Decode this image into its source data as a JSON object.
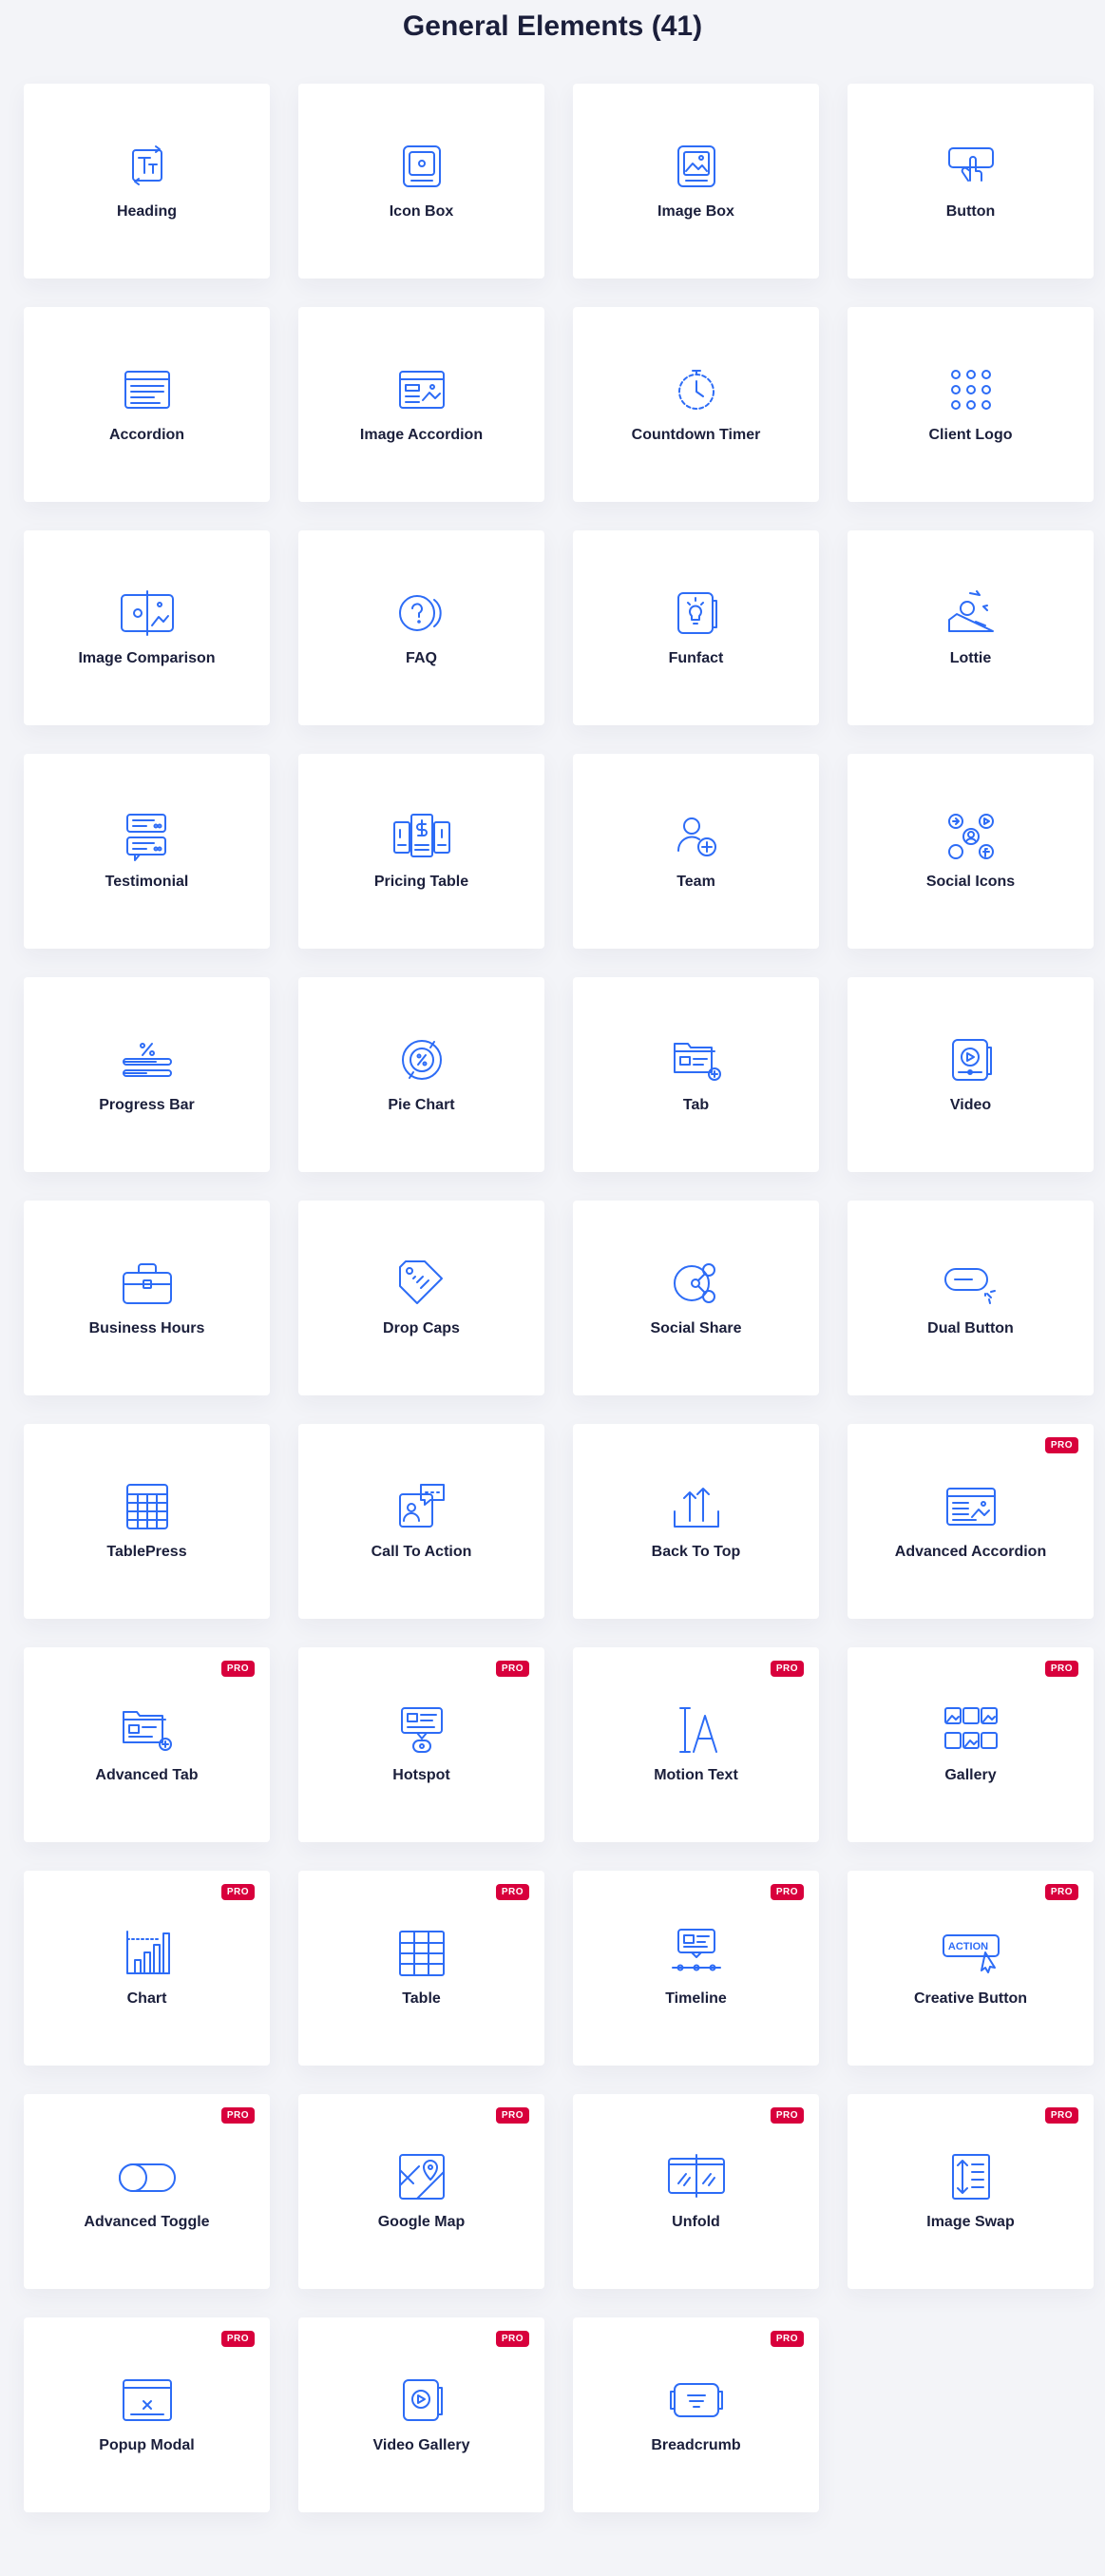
{
  "page": {
    "title": "General Elements (41)"
  },
  "badge_label": "PRO",
  "colors": {
    "icon": "#2d6cf6",
    "pro_badge": "#d8003c",
    "text": "#1b1f3b"
  },
  "elements": [
    {
      "label": "Heading",
      "icon": "heading-icon",
      "pro": false
    },
    {
      "label": "Icon Box",
      "icon": "icon-box-icon",
      "pro": false
    },
    {
      "label": "Image Box",
      "icon": "image-box-icon",
      "pro": false
    },
    {
      "label": "Button",
      "icon": "button-icon",
      "pro": false
    },
    {
      "label": "Accordion",
      "icon": "accordion-icon",
      "pro": false
    },
    {
      "label": "Image Accordion",
      "icon": "image-accordion-icon",
      "pro": false
    },
    {
      "label": "Countdown Timer",
      "icon": "countdown-timer-icon",
      "pro": false
    },
    {
      "label": "Client Logo",
      "icon": "client-logo-icon",
      "pro": false
    },
    {
      "label": "Image Comparison",
      "icon": "image-comparison-icon",
      "pro": false
    },
    {
      "label": "FAQ",
      "icon": "faq-icon",
      "pro": false
    },
    {
      "label": "Funfact",
      "icon": "funfact-icon",
      "pro": false
    },
    {
      "label": "Lottie",
      "icon": "lottie-icon",
      "pro": false
    },
    {
      "label": "Testimonial",
      "icon": "testimonial-icon",
      "pro": false
    },
    {
      "label": "Pricing Table",
      "icon": "pricing-table-icon",
      "pro": false
    },
    {
      "label": "Team",
      "icon": "team-icon",
      "pro": false
    },
    {
      "label": "Social Icons",
      "icon": "social-icons-icon",
      "pro": false
    },
    {
      "label": "Progress Bar",
      "icon": "progress-bar-icon",
      "pro": false
    },
    {
      "label": "Pie Chart",
      "icon": "pie-chart-icon",
      "pro": false
    },
    {
      "label": "Tab",
      "icon": "tab-icon",
      "pro": false
    },
    {
      "label": "Video",
      "icon": "video-icon",
      "pro": false
    },
    {
      "label": "Business Hours",
      "icon": "business-hours-icon",
      "pro": false
    },
    {
      "label": "Drop Caps",
      "icon": "drop-caps-icon",
      "pro": false
    },
    {
      "label": "Social Share",
      "icon": "social-share-icon",
      "pro": false
    },
    {
      "label": "Dual Button",
      "icon": "dual-button-icon",
      "pro": false
    },
    {
      "label": "TablePress",
      "icon": "tablepress-icon",
      "pro": false
    },
    {
      "label": "Call To Action",
      "icon": "call-to-action-icon",
      "pro": false
    },
    {
      "label": "Back To Top",
      "icon": "back-to-top-icon",
      "pro": false
    },
    {
      "label": "Advanced Accordion",
      "icon": "advanced-accordion-icon",
      "pro": true
    },
    {
      "label": "Advanced Tab",
      "icon": "advanced-tab-icon",
      "pro": true
    },
    {
      "label": "Hotspot",
      "icon": "hotspot-icon",
      "pro": true
    },
    {
      "label": "Motion Text",
      "icon": "motion-text-icon",
      "pro": true
    },
    {
      "label": "Gallery",
      "icon": "gallery-icon",
      "pro": true
    },
    {
      "label": "Chart",
      "icon": "chart-icon",
      "pro": true
    },
    {
      "label": "Table",
      "icon": "table-icon",
      "pro": true
    },
    {
      "label": "Timeline",
      "icon": "timeline-icon",
      "pro": true
    },
    {
      "label": "Creative Button",
      "icon": "creative-button-icon",
      "pro": true,
      "icon_text": "ACTION"
    },
    {
      "label": "Advanced Toggle",
      "icon": "advanced-toggle-icon",
      "pro": true
    },
    {
      "label": "Google Map",
      "icon": "google-map-icon",
      "pro": true
    },
    {
      "label": "Unfold",
      "icon": "unfold-icon",
      "pro": true
    },
    {
      "label": "Image Swap",
      "icon": "image-swap-icon",
      "pro": true
    },
    {
      "label": "Popup Modal",
      "icon": "popup-modal-icon",
      "pro": true
    },
    {
      "label": "Video Gallery",
      "icon": "video-gallery-icon",
      "pro": true
    },
    {
      "label": "Breadcrumb",
      "icon": "breadcrumb-icon",
      "pro": true
    }
  ]
}
